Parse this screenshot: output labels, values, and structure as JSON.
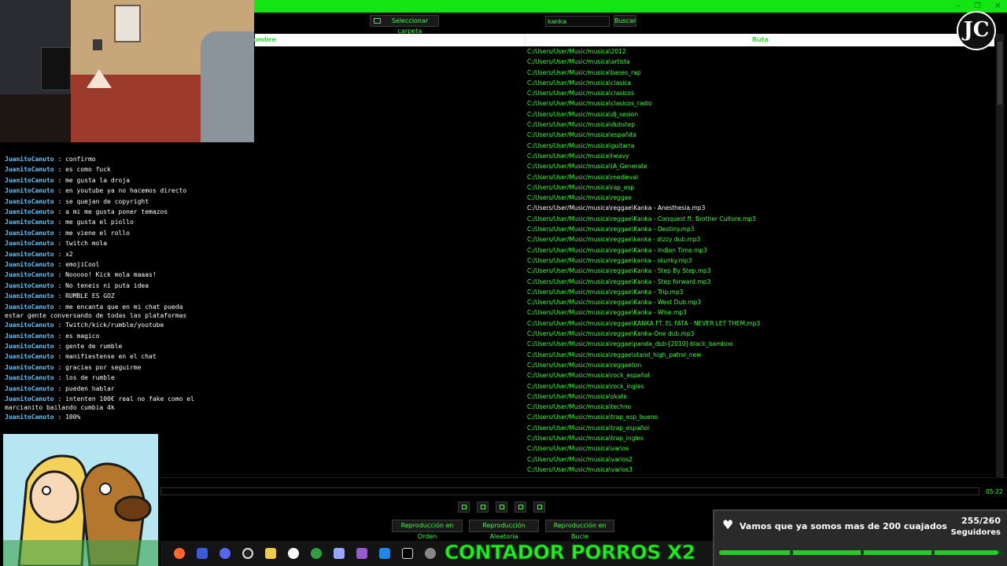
{
  "window": {
    "controls": [
      "–",
      "❐",
      "✕"
    ]
  },
  "toolbar": {
    "select_folder_label": "Seleccionar carpeta",
    "search_value": "kanka",
    "search_button_label": "Buscar"
  },
  "table": {
    "columns": [
      "ombre",
      "Ruta"
    ],
    "selected_index": 15,
    "rows": [
      "C:/Users/User/Music/musica\\2012",
      "C:/Users/User/Music/musica\\artista",
      "C:/Users/User/Music/musica\\bases_rap",
      "C:/Users/User/Music/musica\\clasica",
      "C:/Users/User/Music/musica\\clasicos",
      "C:/Users/User/Music/musica\\clasicos_radio",
      "C:/Users/User/Music/musica\\dj_sesion",
      "C:/Users/User/Music/musica\\dubstep",
      "C:/Users/User/Music/musica\\españita",
      "C:/Users/User/Music/musica\\guitarra",
      "C:/Users/User/Music/musica\\heavy",
      "C:/Users/User/Music/musica\\IA_Generate",
      "C:/Users/User/Music/musica\\medieval",
      "C:/Users/User/Music/musica\\rap_esp",
      "C:/Users/User/Music/musica\\reggae",
      "C:/Users/User/Music/musica\\reggae\\Kanka - Anesthesia.mp3",
      "C:/Users/User/Music/musica\\reggae\\Kanka - Conquest ft. Brother Culture.mp3",
      "C:/Users/User/Music/musica\\reggae\\Kanka - Destiny.mp3",
      "C:/Users/User/Music/musica\\reggae\\kanka - dizzy dub.mp3",
      "C:/Users/User/Music/musica\\reggae\\Kanka - Indian Time.mp3",
      "C:/Users/User/Music/musica\\reggae\\kanka - skunky.mp3",
      "C:/Users/User/Music/musica\\reggae\\Kanka - Step By Step.mp3",
      "C:/Users/User/Music/musica\\reggae\\Kanka - Step forward.mp3",
      "C:/Users/User/Music/musica\\reggae\\Kanka - Trip.mp3",
      "C:/Users/User/Music/musica\\reggae\\Kanka - West Dub.mp3",
      "C:/Users/User/Music/musica\\reggae\\Kanka - Wise.mp3",
      "C:/Users/User/Music/musica\\reggae\\KANKA FT. EL FATA - NEVER LET THEM.mp3",
      "C:/Users/User/Music/musica\\reggae\\Kanka-One dub.mp3",
      "C:/Users/User/Music/musica\\reggae\\panda_dub-[2010]-black_bamboo",
      "C:/Users/User/Music/musica\\reggae\\stand_high_patrol_new",
      "C:/Users/User/Music/musica\\reggaeton",
      "C:/Users/User/Music/musica\\rock_español",
      "C:/Users/User/Music/musica\\rock_ingles",
      "C:/Users/User/Music/musica\\skate",
      "C:/Users/User/Music/musica\\techno",
      "C:/Users/User/Music/musica\\trap_esp_bueno",
      "C:/Users/User/Music/musica\\trap_español",
      "C:/Users/User/Music/musica\\trap_ingles",
      "C:/Users/User/Music/musica\\varios",
      "C:/Users/User/Music/musica\\varios2",
      "C:/Users/User/Music/musica\\varios3"
    ]
  },
  "chat": {
    "messages": [
      {
        "user": "JuanitoCanuto",
        "text": " : confirmo"
      },
      {
        "user": "JuanitoCanuto",
        "text": " : es como fuck"
      },
      {
        "user": "JuanitoCanuto",
        "text": " : me gusta la droja"
      },
      {
        "user": "JuanitoCanuto",
        "text": " : en youtube ya no hacemos directo"
      },
      {
        "user": "JuanitoCanuto",
        "text": " : se quejan de copyright"
      },
      {
        "user": "JuanitoCanuto",
        "text": " : a mi me gusta poner temazos"
      },
      {
        "user": "JuanitoCanuto",
        "text": " : me gusta el piollo"
      },
      {
        "user": "JuanitoCanuto",
        "text": " : me viene el rollo"
      },
      {
        "user": "JuanitoCanuto",
        "text": " : twitch mola"
      },
      {
        "user": "JuanitoCanuto",
        "text": " : x2"
      },
      {
        "user": "JuanitoCanuto",
        "text": " : emojiCool"
      },
      {
        "user": "JuanitoCanuto",
        "text": " : Nooooo! Kick mola maaas!"
      },
      {
        "user": "JuanitoCanuto",
        "text": " : No teneis ni puta idea"
      },
      {
        "user": "JuanitoCanuto",
        "text": " : RUMBLE ES GOZ"
      },
      {
        "user": "JuanitoCanuto",
        "text": " : me encanta que en mi chat pueda",
        "cont": "estar gente conversando de todas las plataformas"
      },
      {
        "user": "JuanitoCanuto",
        "text": " : Twitch/kick/rumble/youtube"
      },
      {
        "user": "JuanitoCanuto",
        "text": " : es magico"
      },
      {
        "user": "JuanitoCanuto",
        "text": " : gente de rumble"
      },
      {
        "user": "JuanitoCanuto",
        "text": " : manifiestense en el chat"
      },
      {
        "user": "JuanitoCanuto",
        "text": " : gracias por seguirme"
      },
      {
        "user": "JuanitoCanuto",
        "text": " : los de rumble"
      },
      {
        "user": "JuanitoCanuto",
        "text": " : pueden hablar"
      },
      {
        "user": "JuanitoCanuto",
        "text": " : intenten 100€ real no fake como el",
        "cont": "marcianito bailando cumbia 4k"
      },
      {
        "user": "JuanitoCanuto",
        "text": " : 100%"
      }
    ]
  },
  "player": {
    "time": "05:22",
    "progress": 0.0,
    "transport": [
      "prev",
      "play",
      "pause",
      "stop",
      "next"
    ],
    "modes": [
      "Reproducción en Orden",
      "Reproducción Aleatoria",
      "Reproducción en Bucle"
    ]
  },
  "overlay": {
    "counter_text": "CONTADOR PORROS X2",
    "goal_title": "Vamos que ya somos mas de 200 cuajados",
    "goal_count": "255/260",
    "goal_label": "Seguidores",
    "goal_fraction": 0.98,
    "logo_text": "JC"
  },
  "taskbar": {
    "icons": [
      "firefox-icon",
      "v-icon",
      "discord-icon",
      "obs-icon",
      "folder-icon",
      "github-icon",
      "xbox-icon",
      "shield-icon",
      "visual-studio-icon",
      "vscode-icon",
      "terminal-icon",
      "settings-icon"
    ]
  },
  "colors": {
    "accent": "#12e512",
    "text_green": "#39ff39",
    "chat_user": "#5ec8ff"
  }
}
